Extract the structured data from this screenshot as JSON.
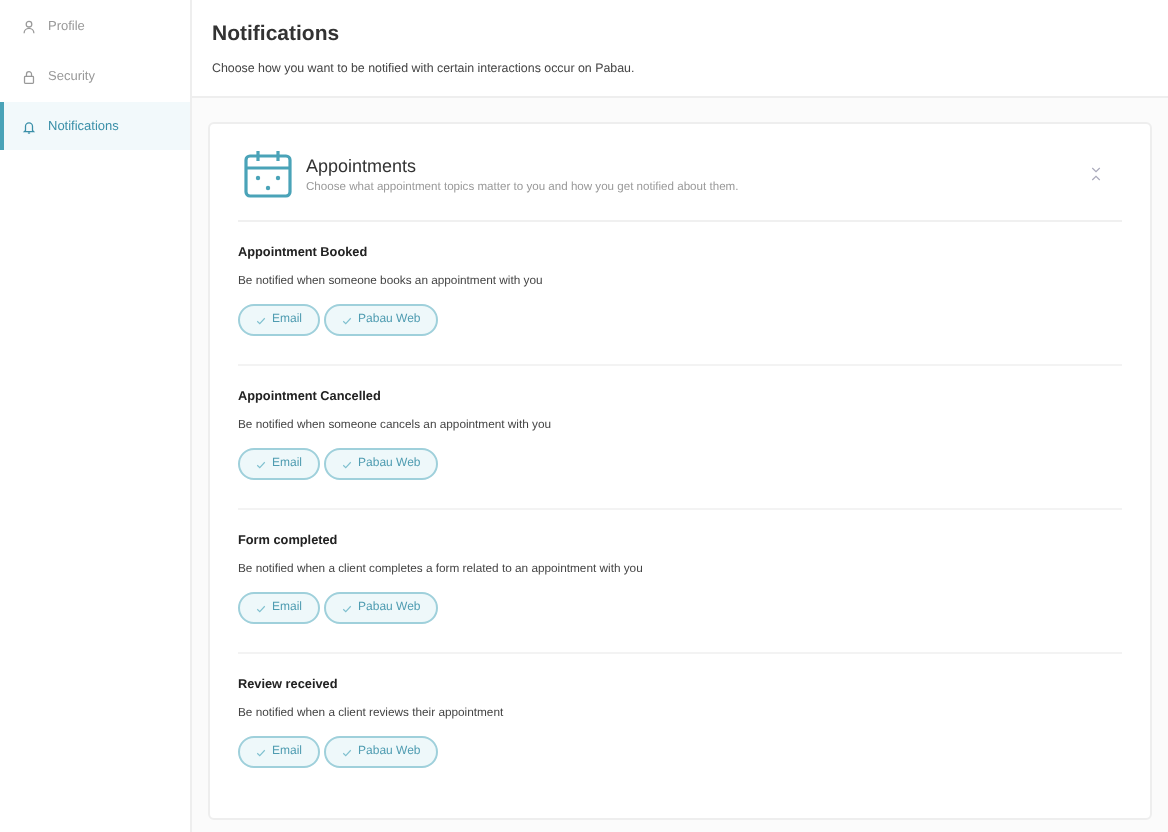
{
  "sidebar": {
    "items": [
      {
        "label": "Profile",
        "selected": false
      },
      {
        "label": "Security",
        "selected": false
      },
      {
        "label": "Notifications",
        "selected": true
      }
    ]
  },
  "page": {
    "title": "Notifications",
    "subtitle": "Choose how you want to be notified with certain interactions occur on Pabau."
  },
  "card": {
    "title": "Appointments",
    "subtitle": "Choose what appointment topics matter to you and how you get notified about them.",
    "sections": [
      {
        "title": "Appointment Booked",
        "description": "Be notified when someone books an appointment with you",
        "channels": [
          {
            "label": "Email",
            "checked": true
          },
          {
            "label": "Pabau Web",
            "checked": true
          }
        ]
      },
      {
        "title": "Appointment Cancelled",
        "description": "Be notified when someone cancels an appointment with you",
        "channels": [
          {
            "label": "Email",
            "checked": true
          },
          {
            "label": "Pabau Web",
            "checked": true
          }
        ]
      },
      {
        "title": "Form completed",
        "description": "Be notified when a client completes a form related to an appointment with you",
        "channels": [
          {
            "label": "Email",
            "checked": true
          },
          {
            "label": "Pabau Web",
            "checked": true
          }
        ]
      },
      {
        "title": "Review received",
        "description": "Be notified when a client reviews their appointment",
        "channels": [
          {
            "label": "Email",
            "checked": true
          },
          {
            "label": "Pabau Web",
            "checked": true
          }
        ]
      }
    ]
  }
}
